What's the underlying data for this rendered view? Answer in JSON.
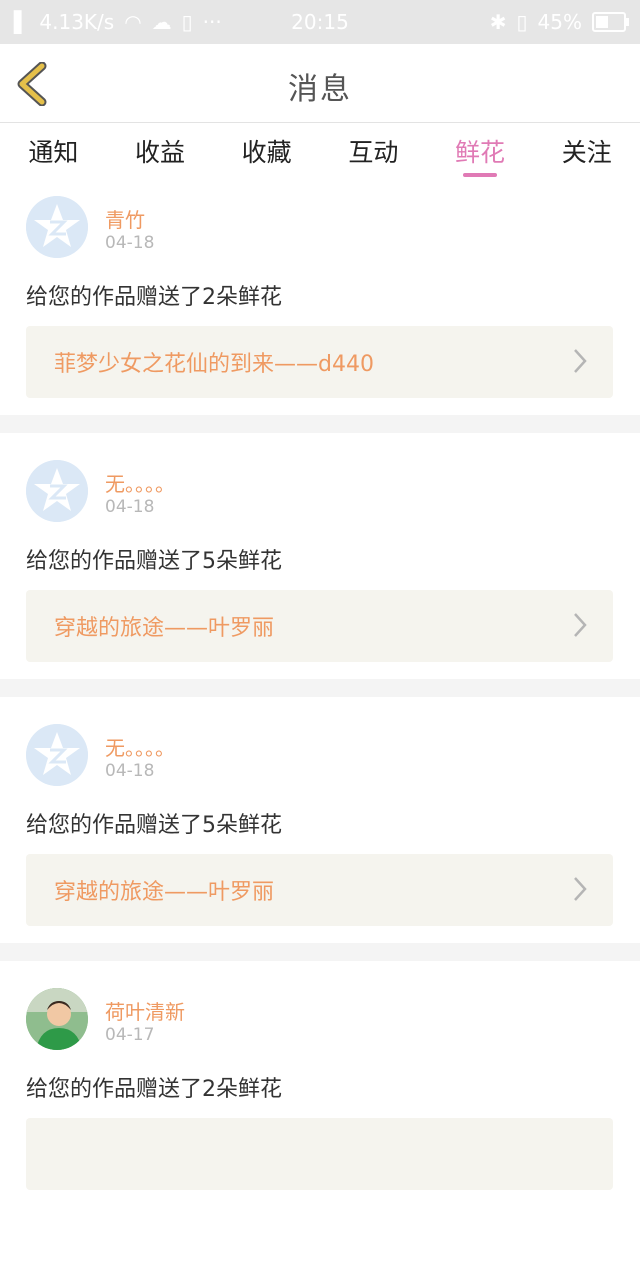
{
  "status_bar": {
    "network_speed": "4.13K/s",
    "time": "20:15",
    "battery": "45%",
    "battery_level": 0.45,
    "icons": [
      "signal-icon",
      "wifi-icon",
      "cloud-icon",
      "sim-icon",
      "more-icon",
      "bluetooth-icon",
      "vibrate-icon",
      "battery-icon"
    ]
  },
  "header": {
    "title": "消息",
    "back_icon": "chevron-left-icon"
  },
  "tabs": [
    {
      "label": "通知",
      "active": false
    },
    {
      "label": "收益",
      "active": false
    },
    {
      "label": "收藏",
      "active": false
    },
    {
      "label": "互动",
      "active": false
    },
    {
      "label": "鲜花",
      "active": true
    },
    {
      "label": "关注",
      "active": false
    }
  ],
  "messages": [
    {
      "user": "青竹",
      "date": "04-18",
      "text": "给您的作品赠送了2朵鲜花",
      "work": "菲梦少女之花仙的到来——d440"
    },
    {
      "user": "无。。。。",
      "date": "04-18",
      "text": "给您的作品赠送了5朵鲜花",
      "work": "穿越的旅途——叶罗丽"
    },
    {
      "user": "无。。。。",
      "date": "04-18",
      "text": "给您的作品赠送了5朵鲜花",
      "work": "穿越的旅途——叶罗丽"
    },
    {
      "user": "荷叶清新",
      "date": "04-17",
      "text": "给您的作品赠送了2朵鲜花",
      "work": ""
    }
  ],
  "colors": {
    "accent": "#e07ab5",
    "name": "#ef9a62",
    "back_arrow": "#e5c04a"
  }
}
